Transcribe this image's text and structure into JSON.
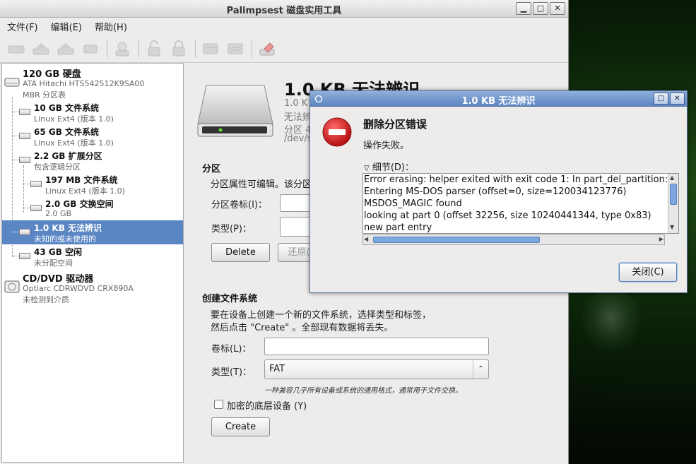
{
  "main_window": {
    "title": "Palimpsest 磁盘实用工具",
    "controls": {
      "minimize": "□",
      "maximize": "□",
      "close": "✕"
    }
  },
  "menu": [
    {
      "label": "文件(F)"
    },
    {
      "label": "编辑(E)"
    },
    {
      "label": "帮助(H)"
    }
  ],
  "sidebar": {
    "items": [
      {
        "title": "120 GB 硬盘",
        "line2": "ATA Hitachi HTS542512K9SA00",
        "line3": "MBR 分区表"
      },
      {
        "title": "10 GB 文件系统",
        "line2": "Linux Ext4 (版本 1.0)"
      },
      {
        "title": "65 GB 文件系统",
        "line2": "Linux Ext4 (版本 1.0)"
      },
      {
        "title": "2.2 GB 扩展分区",
        "line2": "包含逻辑分区"
      },
      {
        "title": "197 MB 文件系统",
        "line2": "Linux Ext4 (版本 1.0)"
      },
      {
        "title": "2.0 GB 交换空间",
        "line2": "2.0 GB"
      },
      {
        "title": "1.0 KB 无法辨识",
        "line2": "未知的或未使用的"
      },
      {
        "title": "43 GB 空闲",
        "line2": "未分配空间"
      },
      {
        "title": "CD/DVD 驱动器",
        "line2": "Optiarc CDRWDVD CRX890A",
        "line3": "未检测到介质"
      }
    ]
  },
  "content": {
    "title": "1.0 KB 无法辨识",
    "info_lines": [
      "1.0 K",
      "无法辨",
      "分区 4",
      "/dev/s"
    ],
    "partition_section": {
      "title": "分区",
      "description": "分区属性可编辑。该分区",
      "label_field": "分区卷标(I)：",
      "type_field": "类型(P)：",
      "delete_button": "Delete",
      "restore_button": "还原("
    },
    "create_section": {
      "title": "创建文件系统",
      "desc1": "要在设备上创建一个新的文件系统，选择类型和标签，",
      "desc2": "然后点击 \"Create\" 。全部现有数据将丢失。",
      "label_field": "卷标(L)：",
      "label_value": "",
      "type_field": "类型(T)：",
      "type_value": "FAT",
      "type_hint": "一种兼容几乎所有设备或系统的通用格式，通常用于文件交换。",
      "encrypt_label": "加密的底层设备 (Y)",
      "create_button": "Create"
    }
  },
  "dialog": {
    "title": "1.0 KB 无法辨识",
    "heading": "删除分区错误",
    "subtext": "操作失败。",
    "details_label": "细节(D)：",
    "log_lines": [
      "Error erasing: helper exited with exit code 1: In part_del_partition:",
      "Entering MS-DOS parser (offset=0, size=120034123776)",
      "MSDOS_MAGIC found",
      "looking at part 0 (offset 32256, size 10240441344, type 0x83)",
      "new part entry"
    ],
    "close_button": "关闭(C)"
  },
  "colors": {
    "selection": "#5a86c4",
    "dialog_title": "#5d85c2",
    "error_icon": "#d21f1f"
  }
}
